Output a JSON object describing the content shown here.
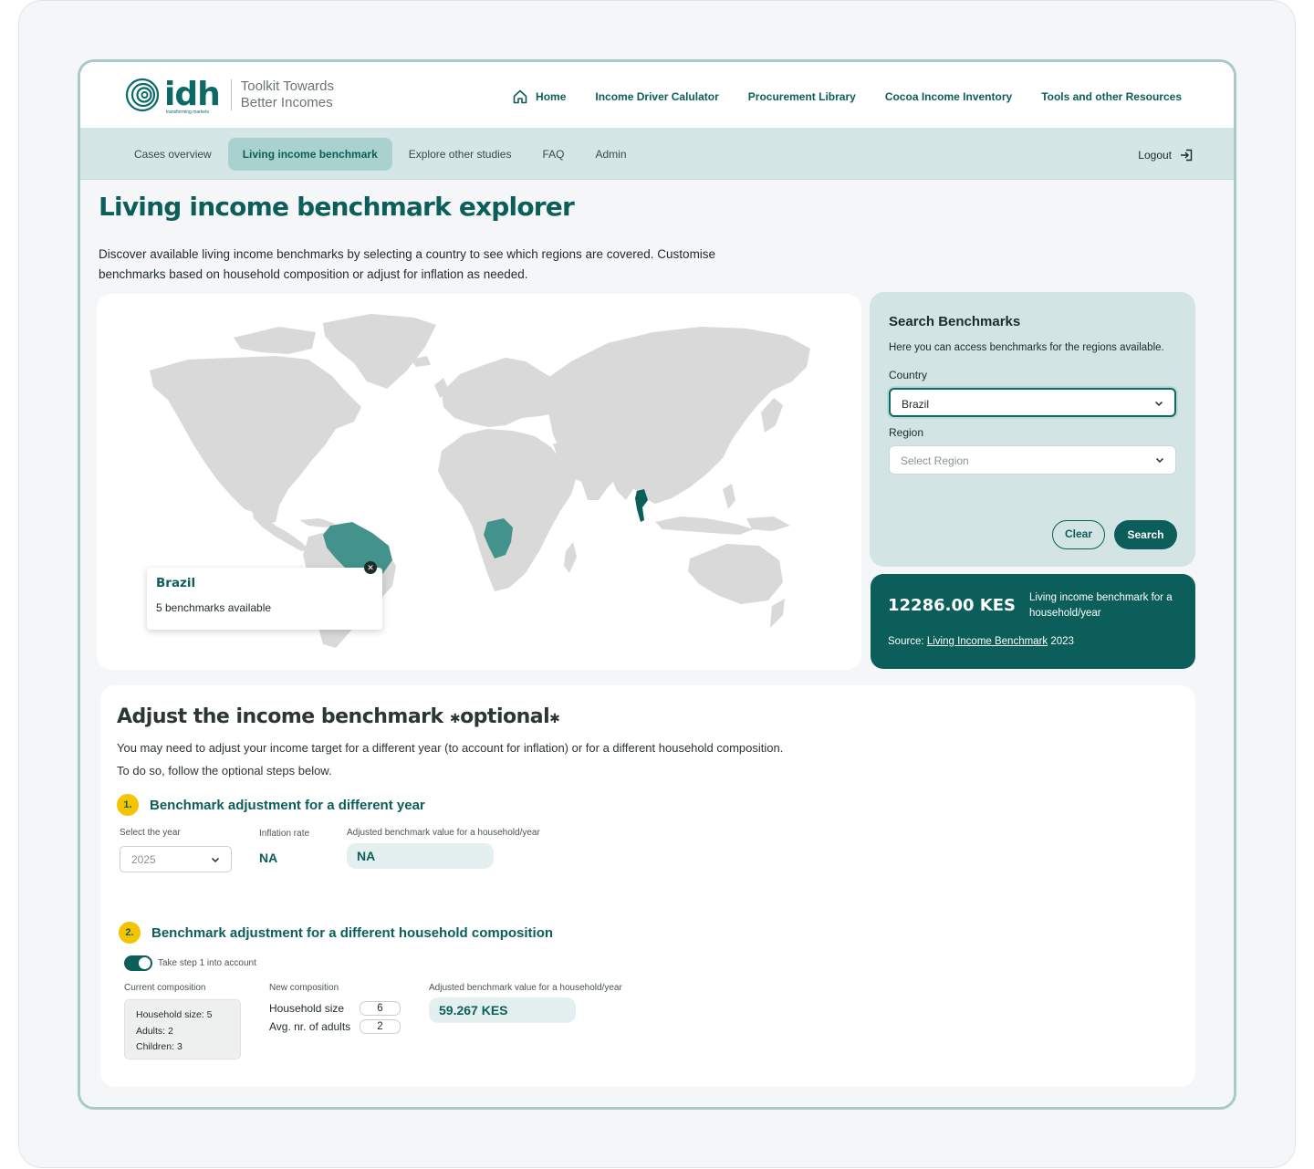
{
  "header": {
    "logo_text": "idh",
    "logo_tagline": "transforming markets",
    "app_title": "Toolkit Towards Better Incomes",
    "nav": [
      {
        "label": "Home",
        "icon": "home-icon"
      },
      {
        "label": "Income Driver Calulator"
      },
      {
        "label": "Procurement Library"
      },
      {
        "label": "Cocoa Income Inventory"
      },
      {
        "label": "Tools and other Resources"
      }
    ]
  },
  "subnav": {
    "items": [
      "Cases overview",
      "Living income benchmark",
      "Explore other studies",
      "FAQ",
      "Admin"
    ],
    "active": "Living income benchmark",
    "logout": "Logout"
  },
  "page": {
    "title": "Living income benchmark explorer",
    "intro": "Discover available living income benchmarks by selecting a country to see which regions are covered. Customise benchmarks based on household composition or adjust for inflation as needed."
  },
  "map": {
    "highlighted_countries": [
      "Brazil",
      "DR Congo",
      "Thailand"
    ],
    "tooltip": {
      "title": "Brazil",
      "subtitle": "5 benchmarks available"
    },
    "colors": {
      "land": "#d9d9d9",
      "highlight": "#43938c",
      "highlight_dark": "#0b5e5a"
    }
  },
  "search": {
    "title": "Search Benchmarks",
    "description": "Here you can access benchmarks for the regions available.",
    "country_label": "Country",
    "country_value": "Brazil",
    "region_label": "Region",
    "region_placeholder": "Select Region",
    "clear_label": "Clear",
    "search_label": "Search"
  },
  "result": {
    "value": "12286.00 KES",
    "label": "Living income benchmark for a household/year",
    "source_prefix": "Source:",
    "source_link": "Living Income Benchmark",
    "source_year": "2023"
  },
  "adjust": {
    "title": "Adjust the income benchmark",
    "title_suffix": "optional",
    "desc_line1": "You may need to adjust your income target for a different year (to account for inflation) or for a different household composition.",
    "desc_line2": "To do so, follow the optional steps below.",
    "step1": {
      "num": "1.",
      "title": "Benchmark adjustment for a different year",
      "year_label": "Select the year",
      "year_value": "2025",
      "inflation_label": "Inflation rate",
      "inflation_value": "NA",
      "adjusted_label": "Adjusted benchmark value for a household/year",
      "adjusted_value": "NA"
    },
    "step2": {
      "num": "2.",
      "title": "Benchmark adjustment for a different household composition",
      "toggle_label": "Take step 1 into account",
      "toggle_on": true,
      "current_label": "Current composition",
      "current_lines": [
        "Household size: 5",
        "Adults: 2",
        "Children: 3"
      ],
      "new_label": "New composition",
      "household_size_label": "Household size",
      "household_size_value": "6",
      "adults_label": "Avg. nr. of adults",
      "adults_value": "2",
      "adjusted_label": "Adjusted benchmark value for a household/year",
      "adjusted_value": "59.267 KES"
    }
  }
}
